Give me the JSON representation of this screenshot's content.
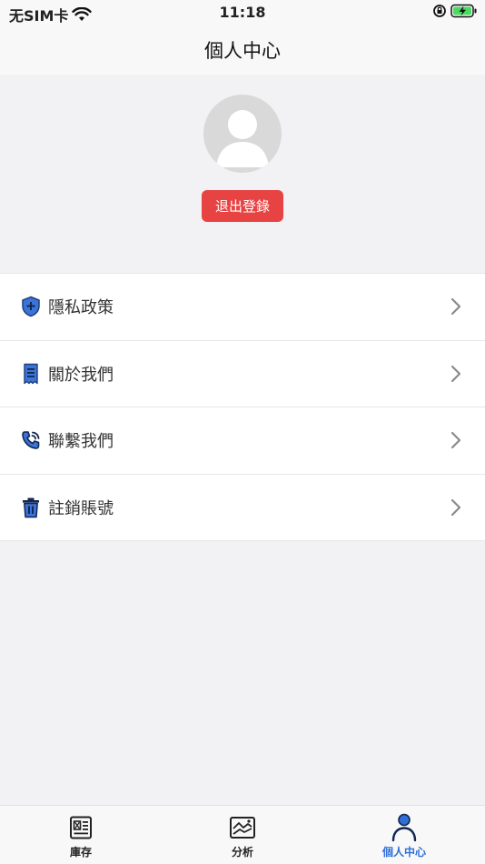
{
  "status": {
    "carrier": "无SIM卡",
    "time": "11:18"
  },
  "nav": {
    "title": "個人中心"
  },
  "profile": {
    "logout_label": "退出登錄"
  },
  "menu": {
    "items": [
      {
        "label": "隱私政策",
        "icon": "shield-plus-icon"
      },
      {
        "label": "關於我們",
        "icon": "receipt-icon"
      },
      {
        "label": "聯繫我們",
        "icon": "phone-call-icon"
      },
      {
        "label": "註銷賬號",
        "icon": "trash-icon"
      }
    ]
  },
  "tabs": [
    {
      "label": "庫存",
      "icon": "inventory-icon",
      "active": false
    },
    {
      "label": "分析",
      "icon": "chart-image-icon",
      "active": false
    },
    {
      "label": "個人中心",
      "icon": "user-icon",
      "active": true
    }
  ],
  "colors": {
    "accent": "#2f6fd6",
    "danger": "#e84343",
    "background": "#f2f2f4"
  }
}
